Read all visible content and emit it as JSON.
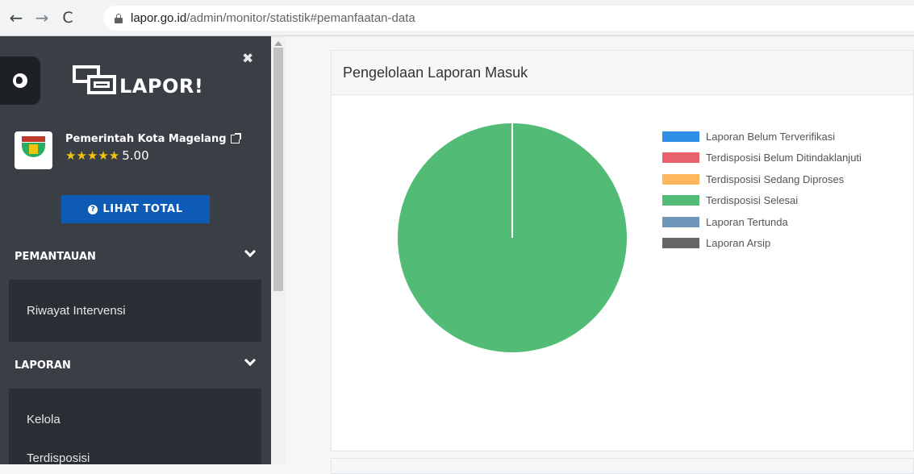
{
  "browser": {
    "url_host": "lapor.go.id",
    "url_path": "/admin/monitor/statistik#pemanfaatan-data"
  },
  "sidebar": {
    "logo_text": "LAPOR!",
    "org_name": "Pemerintah Kota Magelang",
    "rating_stars": "★★★★★",
    "rating_value": "5.00",
    "lihat_total_label": "LIHAT TOTAL",
    "sections": [
      {
        "title": "PEMANTAUAN",
        "items": [
          "Riwayat Intervensi"
        ]
      },
      {
        "title": "LAPORAN",
        "items": [
          "Kelola",
          "Terdisposisi"
        ]
      }
    ]
  },
  "main": {
    "card_title": "Pengelolaan Laporan Masuk"
  },
  "colors": {
    "sidebar_bg": "#3a3f46",
    "button_blue": "#0d5bb5"
  },
  "chart_data": {
    "type": "pie",
    "title": "",
    "legend_position": "right",
    "slices": [
      {
        "name": "Laporan Belum Terverifikasi",
        "value": 0,
        "color": "#2f8ee6"
      },
      {
        "name": "Terdisposisi Belum Ditindaklanjuti",
        "value": 0,
        "color": "#e8636d"
      },
      {
        "name": "Terdisposisi Sedang Diproses",
        "value": 0,
        "color": "#fdb75c"
      },
      {
        "name": "Terdisposisi Selesai",
        "value": 100,
        "color": "#52bb75"
      },
      {
        "name": "Laporan Tertunda",
        "value": 0,
        "color": "#6f96b8"
      },
      {
        "name": "Laporan Arsip",
        "value": 0,
        "color": "#666666"
      }
    ]
  }
}
